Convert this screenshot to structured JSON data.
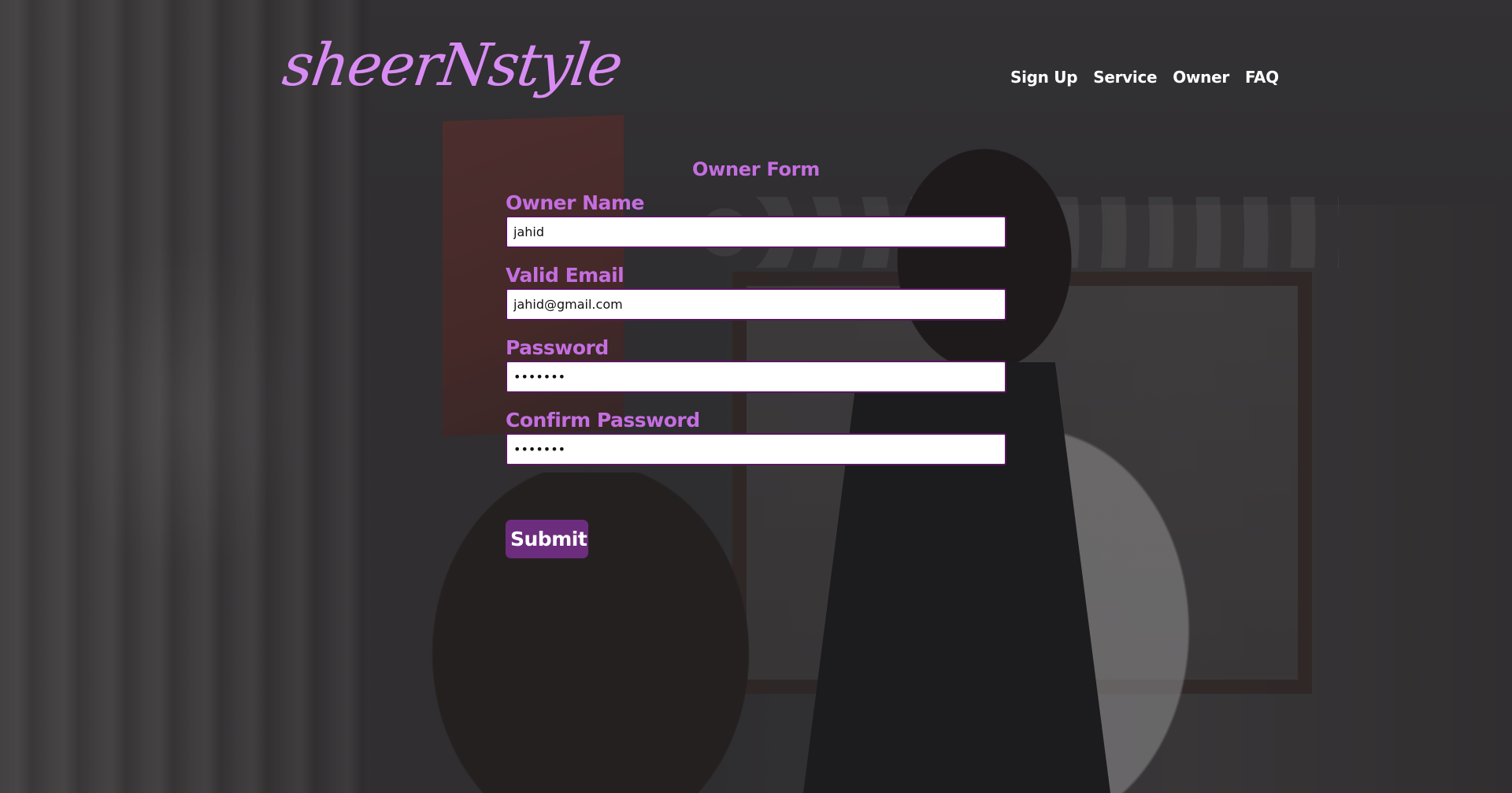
{
  "brand": {
    "logo_text": "sheerNstyle"
  },
  "nav": {
    "items": [
      {
        "label": "Sign Up"
      },
      {
        "label": "Service"
      },
      {
        "label": "Owner"
      },
      {
        "label": "FAQ"
      }
    ]
  },
  "form": {
    "title": "Owner Form",
    "fields": [
      {
        "label": "Owner Name",
        "value": "jahid",
        "type": "text"
      },
      {
        "label": "Valid Email",
        "value": "jahid@gmail.com",
        "type": "email"
      },
      {
        "label": "Password",
        "value": "1234567",
        "type": "password"
      },
      {
        "label": "Confirm Password",
        "value": "1234567",
        "type": "password"
      }
    ],
    "submit_label": "Submit"
  },
  "colors": {
    "accent": "#c46ee0",
    "logo": "#d88cf3",
    "button": "#6d2d7e",
    "input_border": "#5a1560"
  }
}
